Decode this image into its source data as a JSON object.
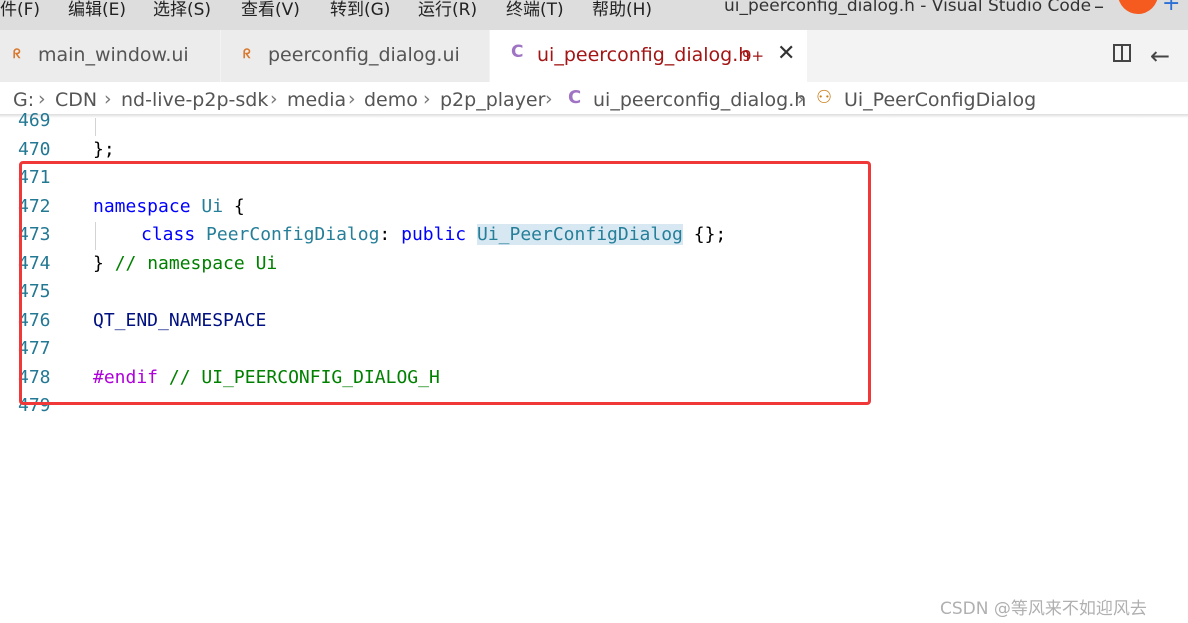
{
  "menubar": {
    "items": [
      "件(F)",
      "编辑(E)",
      "选择(S)",
      "查看(V)",
      "转到(G)",
      "运行(R)",
      "终端(T)",
      "帮助(H)"
    ],
    "window_title": "ui_peerconfig_dialog.h - Visual Studio Code"
  },
  "tabs": [
    {
      "label": "main_window.ui",
      "icon": "rss-icon"
    },
    {
      "label": "peerconfig_dialog.ui",
      "icon": "rss-icon"
    },
    {
      "label": "ui_peerconfig_dialog.h",
      "icon": "c-file-icon",
      "badge": "9+",
      "active": true
    }
  ],
  "breadcrumb": {
    "items": [
      "G:",
      "CDN",
      "nd-live-p2p-sdk",
      "media",
      "demo",
      "p2p_player",
      "ui_peerconfig_dialog.h",
      "Ui_PeerConfigDialog"
    ]
  },
  "editor": {
    "lines": [
      {
        "num": "469"
      },
      {
        "num": "470",
        "text": "};"
      },
      {
        "num": "471"
      },
      {
        "num": "472",
        "kw": "namespace",
        "name": "Ui",
        "brace": " {"
      },
      {
        "num": "473",
        "kw": "class",
        "type": "PeerConfigDialog",
        "sep": ": ",
        "kw2": "public",
        "base": "Ui_PeerConfigDialog",
        "tail": " {};"
      },
      {
        "num": "474",
        "brace": "} ",
        "comment": "// namespace Ui"
      },
      {
        "num": "475"
      },
      {
        "num": "476",
        "macro": "QT_END_NAMESPACE"
      },
      {
        "num": "477"
      },
      {
        "num": "478",
        "pp": "#endif",
        "comment": " // UI_PEERCONFIG_DIALOG_H"
      },
      {
        "num": "479"
      }
    ]
  },
  "watermark": "CSDN @等风来不如迎风去",
  "colors": {
    "annotation_box": "#f03838",
    "active_tab_text": "#a31515",
    "line_numbers": "#237893"
  }
}
